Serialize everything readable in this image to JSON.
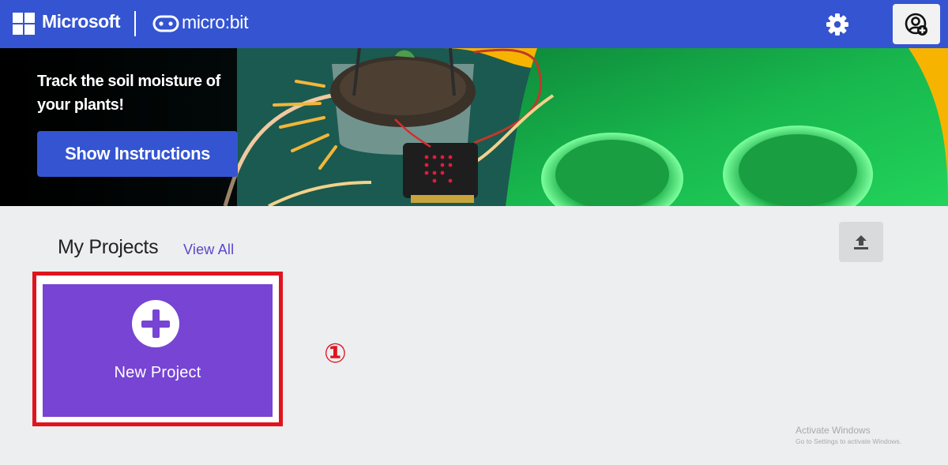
{
  "header": {
    "brand": "Microsoft",
    "product": "micro:bit",
    "icons": {
      "settings": "gear-icon",
      "user": "user-add-icon"
    },
    "colors": {
      "bar": "#3454d1"
    }
  },
  "hero": {
    "title": "Track the soil moisture of your plants!",
    "button_label": "Show Instructions"
  },
  "projects": {
    "title": "My Projects",
    "view_all_label": "View All",
    "import_icon": "upload-icon",
    "new_project_label": "New Project",
    "new_project_icon": "plus-circle-icon",
    "colors": {
      "card": "#7744d4",
      "highlight": "#e0141e"
    }
  },
  "annotation": {
    "step_marker": "①"
  },
  "watermark": {
    "line1": "Activate Windows",
    "line2": "Go to Settings to activate Windows."
  }
}
